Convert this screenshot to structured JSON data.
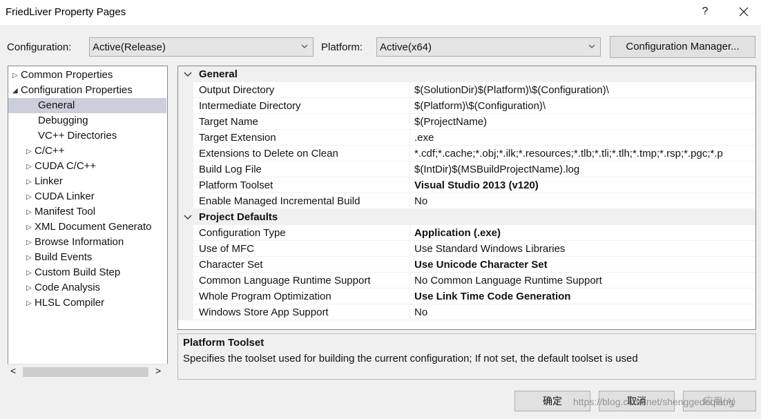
{
  "window": {
    "title": "FriedLiver Property Pages",
    "help": "?",
    "close": "✕"
  },
  "config": {
    "configuration_label": "Configuration:",
    "configuration_value": "Active(Release)",
    "platform_label": "Platform:",
    "platform_value": "Active(x64)",
    "manager_button": "Configuration Manager..."
  },
  "tree": {
    "items": [
      {
        "label": "Common Properties"
      },
      {
        "label": "Configuration Properties"
      },
      {
        "label": "General"
      },
      {
        "label": "Debugging"
      },
      {
        "label": "VC++ Directories"
      },
      {
        "label": "C/C++"
      },
      {
        "label": "CUDA C/C++"
      },
      {
        "label": "Linker"
      },
      {
        "label": "CUDA Linker"
      },
      {
        "label": "Manifest Tool"
      },
      {
        "label": "XML Document Generato"
      },
      {
        "label": "Browse Information"
      },
      {
        "label": "Build Events"
      },
      {
        "label": "Custom Build Step"
      },
      {
        "label": "Code Analysis"
      },
      {
        "label": "HLSL Compiler"
      }
    ],
    "scroll_left": "<",
    "scroll_right": ">"
  },
  "grid": {
    "categories": [
      {
        "title": "General",
        "rows": [
          {
            "name": "Output Directory",
            "value": "$(SolutionDir)$(Platform)\\$(Configuration)\\"
          },
          {
            "name": "Intermediate Directory",
            "value": "$(Platform)\\$(Configuration)\\"
          },
          {
            "name": "Target Name",
            "value": "$(ProjectName)"
          },
          {
            "name": "Target Extension",
            "value": ".exe"
          },
          {
            "name": "Extensions to Delete on Clean",
            "value": "*.cdf;*.cache;*.obj;*.ilk;*.resources;*.tlb;*.tli;*.tlh;*.tmp;*.rsp;*.pgc;*.p"
          },
          {
            "name": "Build Log File",
            "value": "$(IntDir)$(MSBuildProjectName).log"
          },
          {
            "name": "Platform Toolset",
            "value": "Visual Studio 2013 (v120)"
          },
          {
            "name": "Enable Managed Incremental Build",
            "value": "No"
          }
        ]
      },
      {
        "title": "Project Defaults",
        "rows": [
          {
            "name": "Configuration Type",
            "value": "Application (.exe)"
          },
          {
            "name": "Use of MFC",
            "value": "Use Standard Windows Libraries"
          },
          {
            "name": "Character Set",
            "value": "Use Unicode Character Set"
          },
          {
            "name": "Common Language Runtime Support",
            "value": "No Common Language Runtime Support"
          },
          {
            "name": "Whole Program Optimization",
            "value": "Use Link Time Code Generation"
          },
          {
            "name": "Windows Store App Support",
            "value": "No"
          }
        ]
      }
    ]
  },
  "description": {
    "title": "Platform Toolset",
    "text": "Specifies the toolset used for building the current configuration; If not set, the default toolset is used"
  },
  "buttons": {
    "ok": "确定",
    "cancel": "取消",
    "apply": "应用(A)"
  },
  "watermark": "https://blog.csdn.net/shenggedeqiang"
}
